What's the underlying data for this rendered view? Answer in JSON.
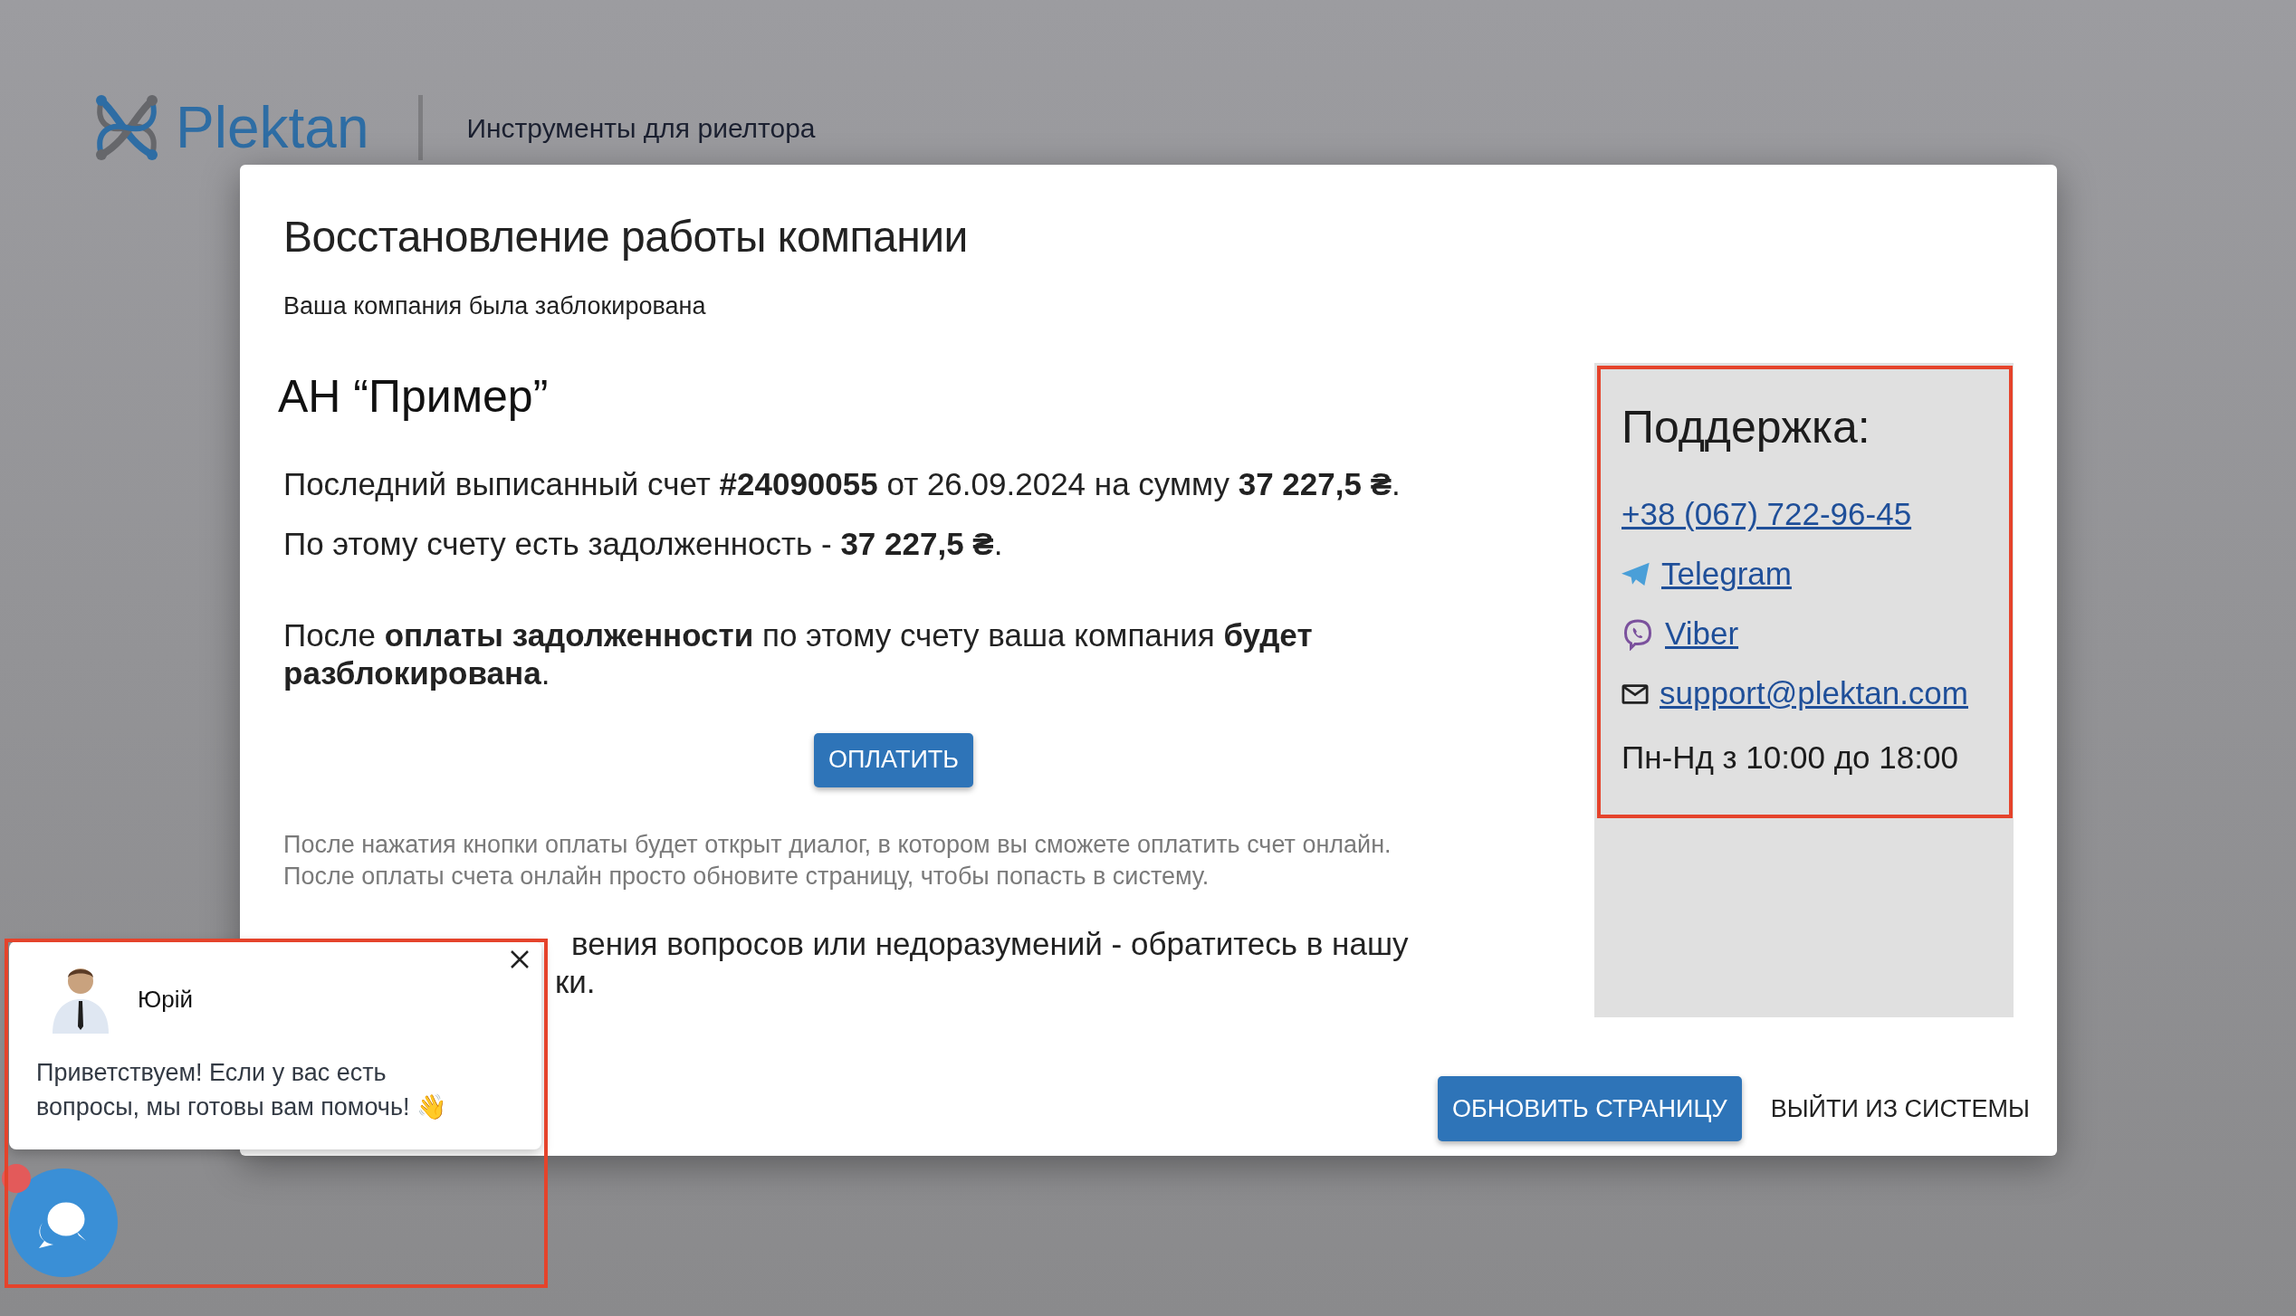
{
  "header": {
    "logo_text": "Plektan",
    "tagline": "Инструменты для риелтора"
  },
  "dialog": {
    "title": "Восстановление работы компании",
    "subtitle": "Ваша компания была заблокирована",
    "company": "АН “Пример”",
    "lines": [
      "Последний выписанный счет **#24090055** от 26.09.2024 на сумму **37 227,5 ₴**.",
      "По этому счету есть задолженность - **37 227,5 ₴**."
    ],
    "unlock_text": "После **оплаты задолженности** по этому счету ваша компания **будет разблокирована**.",
    "pay_button": "ОПЛАТИТЬ",
    "note": [
      "После нажатия кнопки оплаты будет открыт диалог, в котором вы сможете оплатить счет онлайн.",
      "После оплаты счета онлайн просто обновите страницу, чтобы попасть в систему."
    ],
    "contact_text": [
      "вения вопросов или недоразумений - обратитесь в нашу",
      "ки."
    ],
    "support": {
      "title": "Поддержка:",
      "contacts": [
        {
          "kind": "phone",
          "label": "+38 (067) 722-96-45"
        },
        {
          "kind": "telegram",
          "label": "Telegram"
        },
        {
          "kind": "viber",
          "label": "Viber"
        },
        {
          "kind": "email",
          "label": "support@plektan.com"
        }
      ],
      "hours": "Пн-Нд з 10:00 до 18:00"
    },
    "buttons": [
      {
        "label": "ОБНОВИТЬ СТРАНИЦУ",
        "kind": "primary"
      },
      {
        "label": "ВЫЙТИ ИЗ СИСТЕМЫ",
        "kind": "text"
      }
    ]
  },
  "chat": {
    "agent": "Юрій",
    "message": "Приветствуем! Если у вас есть вопросы, мы готовы вам помочь! 👋",
    "unread": true
  }
}
